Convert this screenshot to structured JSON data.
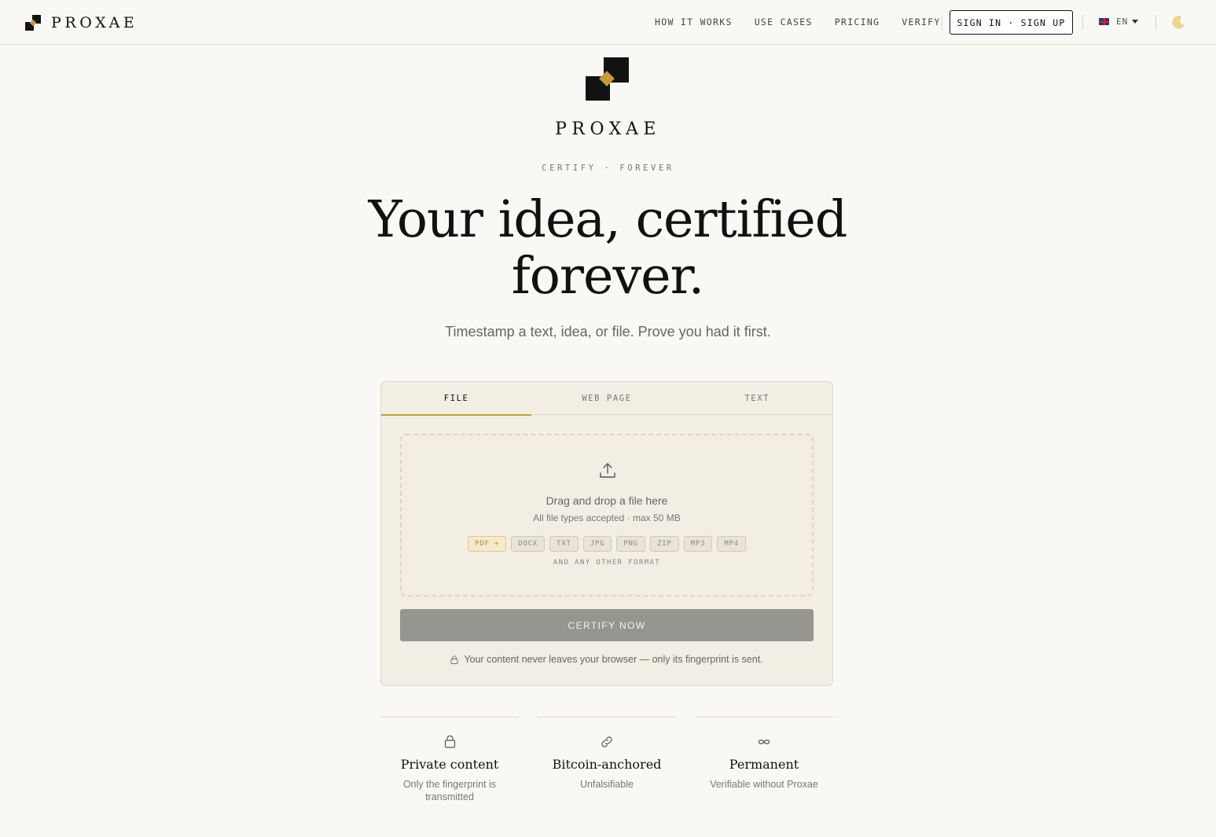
{
  "nav": {
    "brand": "PROXAE",
    "links": [
      "HOW IT WORKS",
      "USE CASES",
      "PRICING",
      "VERIFY"
    ],
    "signin": "SIGN IN · SIGN UP",
    "lang": "EN",
    "theme_icon": "moon-icon"
  },
  "hero": {
    "brand": "PROXAE",
    "tagline": "CERTIFY · FOREVER",
    "headline": "Your idea, certified forever.",
    "subtitle": "Timestamp a text, idea, or file. Prove you had it first."
  },
  "card": {
    "tabs": [
      "FILE",
      "WEB PAGE",
      "TEXT"
    ],
    "active_tab": "FILE",
    "dropzone": {
      "title": "Drag and drop a file here",
      "subtitle": "All file types accepted · max 50 MB",
      "formats": [
        "PDF +",
        "DOCX",
        "TXT",
        "JPG",
        "PNG",
        "ZIP",
        "MP3",
        "MP4"
      ],
      "any": "AND ANY OTHER FORMAT"
    },
    "button": "CERTIFY NOW",
    "privacy": "Your content never leaves your browser — only its fingerprint is sent."
  },
  "features": [
    {
      "icon": "lock-icon",
      "title": "Private content",
      "desc": "Only the fingerprint is transmitted"
    },
    {
      "icon": "link-icon",
      "title": "Bitcoin-anchored",
      "desc": "Unfalsifiable"
    },
    {
      "icon": "infinity-icon",
      "title": "Permanent",
      "desc": "Verifiable without Proxae"
    }
  ],
  "colors": {
    "accent": "#c49a3c",
    "background": "#f9f8f4",
    "card": "#f2eee4"
  }
}
